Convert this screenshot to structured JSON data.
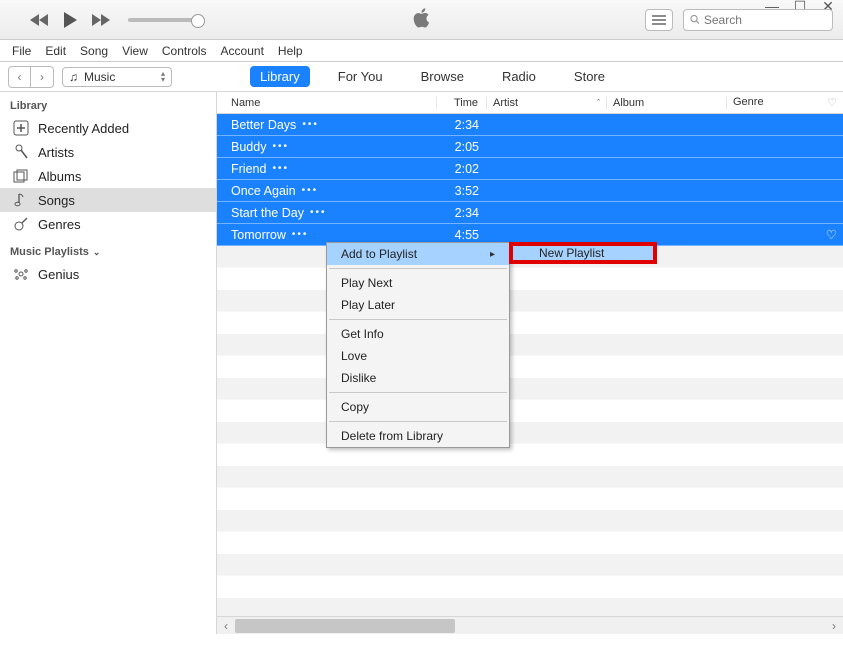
{
  "window_controls": {
    "min": "—",
    "max": "☐",
    "close": "✕"
  },
  "search": {
    "placeholder": "Search"
  },
  "menu": {
    "file": "File",
    "edit": "Edit",
    "song": "Song",
    "view": "View",
    "controls": "Controls",
    "account": "Account",
    "help": "Help"
  },
  "nav": {
    "dropdown_label": "Music",
    "tabs": {
      "library": "Library",
      "for_you": "For You",
      "browse": "Browse",
      "radio": "Radio",
      "store": "Store"
    }
  },
  "sidebar": {
    "header": "Library",
    "items": {
      "recently_added": "Recently Added",
      "artists": "Artists",
      "albums": "Albums",
      "songs": "Songs",
      "genres": "Genres"
    },
    "playlists_header": "Music Playlists",
    "genius": "Genius"
  },
  "columns": {
    "name": "Name",
    "time": "Time",
    "artist": "Artist",
    "album": "Album",
    "genre": "Genre"
  },
  "songs": [
    {
      "name": "Better Days",
      "time": "2:34"
    },
    {
      "name": "Buddy",
      "time": "2:05"
    },
    {
      "name": "Friend",
      "time": "2:02"
    },
    {
      "name": "Once Again",
      "time": "3:52"
    },
    {
      "name": "Start the Day",
      "time": "2:34"
    },
    {
      "name": "Tomorrow",
      "time": "4:55"
    }
  ],
  "context_menu": {
    "add_to_playlist": "Add to Playlist",
    "play_next": "Play Next",
    "play_later": "Play Later",
    "get_info": "Get Info",
    "love": "Love",
    "dislike": "Dislike",
    "copy": "Copy",
    "delete": "Delete from Library"
  },
  "submenu": {
    "new_playlist": "New Playlist"
  }
}
